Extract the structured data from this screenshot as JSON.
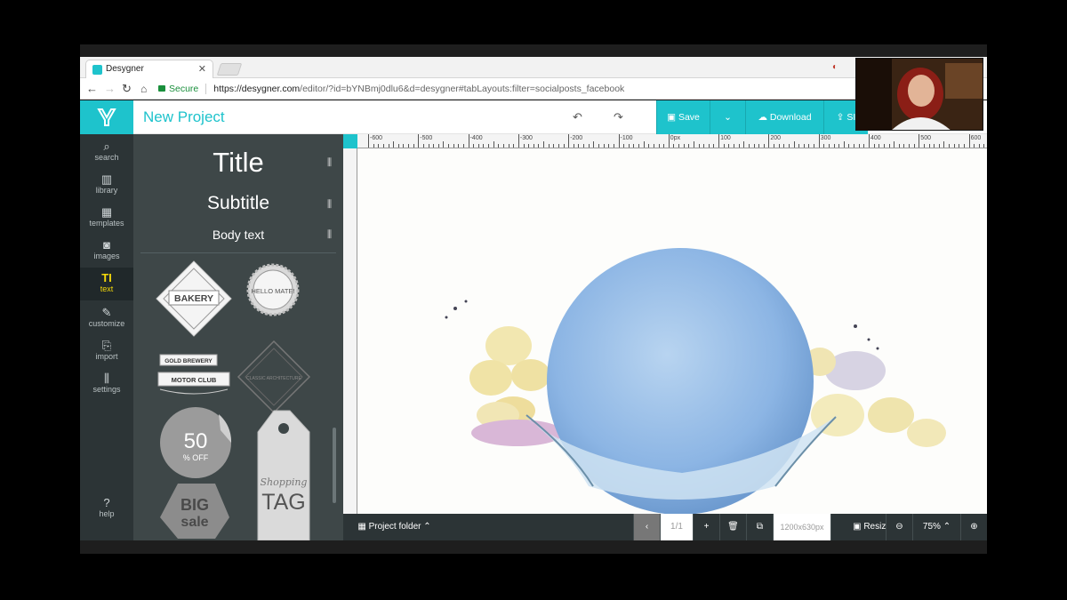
{
  "browser": {
    "tab_title": "Desygner",
    "url_secure": "Secure",
    "url_host": "https://desygner.com",
    "url_path": "/editor/?id=bYNBmj0dlu6&d=desygner#tabLayouts:filter=socialposts_facebook"
  },
  "app": {
    "project_name": "New Project",
    "save_label": "Save",
    "download_label": "Download",
    "share_label": "SI"
  },
  "rail": [
    {
      "label": "search",
      "icon": "search-icon"
    },
    {
      "label": "library",
      "icon": "library-icon"
    },
    {
      "label": "templates",
      "icon": "templates-icon"
    },
    {
      "label": "images",
      "icon": "camera-icon"
    },
    {
      "label": "text",
      "icon": "text-icon"
    },
    {
      "label": "customize",
      "icon": "brush-icon"
    },
    {
      "label": "import",
      "icon": "import-icon"
    },
    {
      "label": "settings",
      "icon": "sliders-icon"
    },
    {
      "label": "help",
      "icon": "help-icon"
    }
  ],
  "text_panel": {
    "title": "Title",
    "subtitle": "Subtitle",
    "body": "Body text",
    "stickers": {
      "bakery": "BAKERY",
      "hello": "HELLO MATE!",
      "gold_brewery": "GOLD BREWERY",
      "motor_club": "MOTOR CLUB",
      "classic": "CLASSIC ARCHITECTURE",
      "fifty": "50",
      "off": "% OFF",
      "shopping": "Shopping",
      "tag": "TAG",
      "big": "BIG",
      "sale": "sale"
    }
  },
  "ruler_labels": [
    "-600",
    "-500",
    "-400",
    "-300",
    "-200",
    "-100",
    "0px",
    "100",
    "200",
    "300",
    "400",
    "500",
    "600"
  ],
  "bottom_bar": {
    "folder_label": "Project folder",
    "page_counter": "1/1",
    "dimensions": "1200x630px",
    "resize_label": "Resize",
    "zoom_level": "75%"
  },
  "colors": {
    "accent": "#1ec3cc",
    "rail_bg": "#2c3436",
    "panel_bg": "#3e4748",
    "active_highlight": "#f5d90a"
  }
}
